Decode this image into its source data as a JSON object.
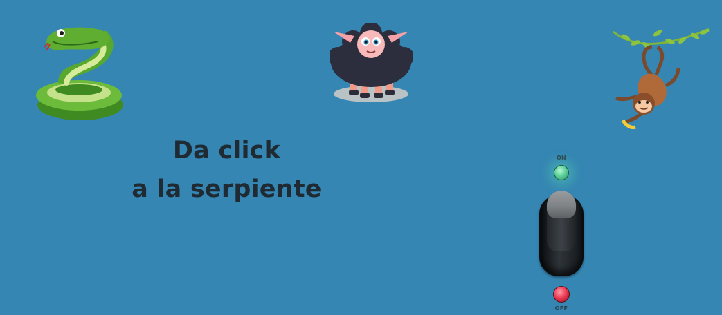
{
  "instruction": {
    "line1": "Da click",
    "line2": "a la serpiente"
  },
  "animals": [
    {
      "name": "snake"
    },
    {
      "name": "sheep"
    },
    {
      "name": "monkey"
    }
  ],
  "switch": {
    "on_label": "ON",
    "off_label": "OFF",
    "state": "on"
  },
  "colors": {
    "background": "#3586b3",
    "text": "#1f2a33",
    "led_on": "#5fd39c",
    "led_off": "#e8354d"
  }
}
